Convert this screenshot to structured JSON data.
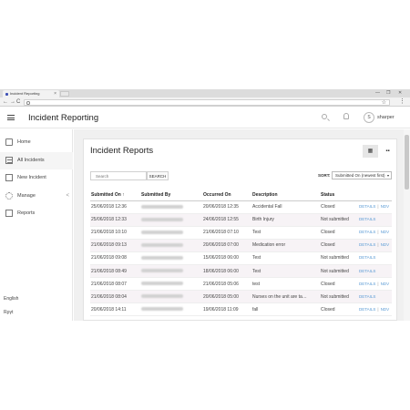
{
  "browser": {
    "tab_title": "Incident Reporting",
    "tab_close": "×",
    "back": "←",
    "forward": "→",
    "reload": "C",
    "home": "⌂",
    "menu": "⋮",
    "star": "☆",
    "min": "—",
    "max": "❐",
    "close": "✕"
  },
  "app": {
    "title": "Incident Reporting",
    "user_initial": "S",
    "user_name": "sharper"
  },
  "sidebar": {
    "items": [
      {
        "label": "Home",
        "icon": "home-icon"
      },
      {
        "label": "All Incidents",
        "icon": "list-icon",
        "active": true
      },
      {
        "label": "New Incident",
        "icon": "edit-icon"
      },
      {
        "label": "Manage",
        "icon": "gear-icon",
        "chevron": "<"
      },
      {
        "label": "Reports",
        "icon": "chart-icon"
      }
    ],
    "languages": [
      "English",
      "Rργt"
    ]
  },
  "main": {
    "title": "Incident Reports",
    "table_view_glyph": "▦",
    "grid_view_glyph": "▪▪",
    "search_placeholder": "Search",
    "search_button": "SEARCH",
    "sort_label": "SORT:",
    "sort_value": "Submitted On (newest first)",
    "sort_caret": "▾",
    "columns": [
      "Submitted On ↑",
      "Submitted By",
      "Occurred On",
      "Description",
      "Status",
      ""
    ],
    "rows": [
      {
        "submitted": "25/06/2018  12:36",
        "occurred": "20/06/2018  12:35",
        "desc": "Accidental Fall",
        "status": "Closed",
        "details": "DETAILS",
        "sep": "|",
        "ndv": "NDV"
      },
      {
        "submitted": "25/06/2018  12:33",
        "occurred": "24/06/2018  12:55",
        "desc": "Birth Injury",
        "status": "Not submitted",
        "details": "DETAILS",
        "sep": "",
        "ndv": ""
      },
      {
        "submitted": "21/06/2018  10:10",
        "occurred": "21/06/2018  07:10",
        "desc": "Test",
        "status": "Closed",
        "details": "DETAILS",
        "sep": "|",
        "ndv": "NDV"
      },
      {
        "submitted": "21/06/2018  09:13",
        "occurred": "20/06/2018  07:00",
        "desc": "Medication error",
        "status": "Closed",
        "details": "DETAILS",
        "sep": "|",
        "ndv": "NDV"
      },
      {
        "submitted": "21/06/2018  09:08",
        "occurred": "15/06/2018  06:00",
        "desc": "Test",
        "status": "Not submitted",
        "details": "DETAILS",
        "sep": "",
        "ndv": ""
      },
      {
        "submitted": "21/06/2018  08:49",
        "occurred": "18/06/2018  06:00",
        "desc": "Test",
        "status": "Not submitted",
        "details": "DETAILS",
        "sep": "",
        "ndv": ""
      },
      {
        "submitted": "21/06/2018  08:07",
        "occurred": "21/06/2018  05:06",
        "desc": "test",
        "status": "Closed",
        "details": "DETAILS",
        "sep": "|",
        "ndv": "NDV"
      },
      {
        "submitted": "21/06/2018  08:04",
        "occurred": "20/06/2018  05:00",
        "desc": "Nurses on the unit are ta…",
        "status": "Not submitted",
        "details": "DETAILS",
        "sep": "",
        "ndv": ""
      },
      {
        "submitted": "20/06/2018  14:11",
        "occurred": "19/06/2018  11:09",
        "desc": "fall",
        "status": "Closed",
        "details": "DETAILS",
        "sep": "|",
        "ndv": "NDV"
      }
    ]
  }
}
